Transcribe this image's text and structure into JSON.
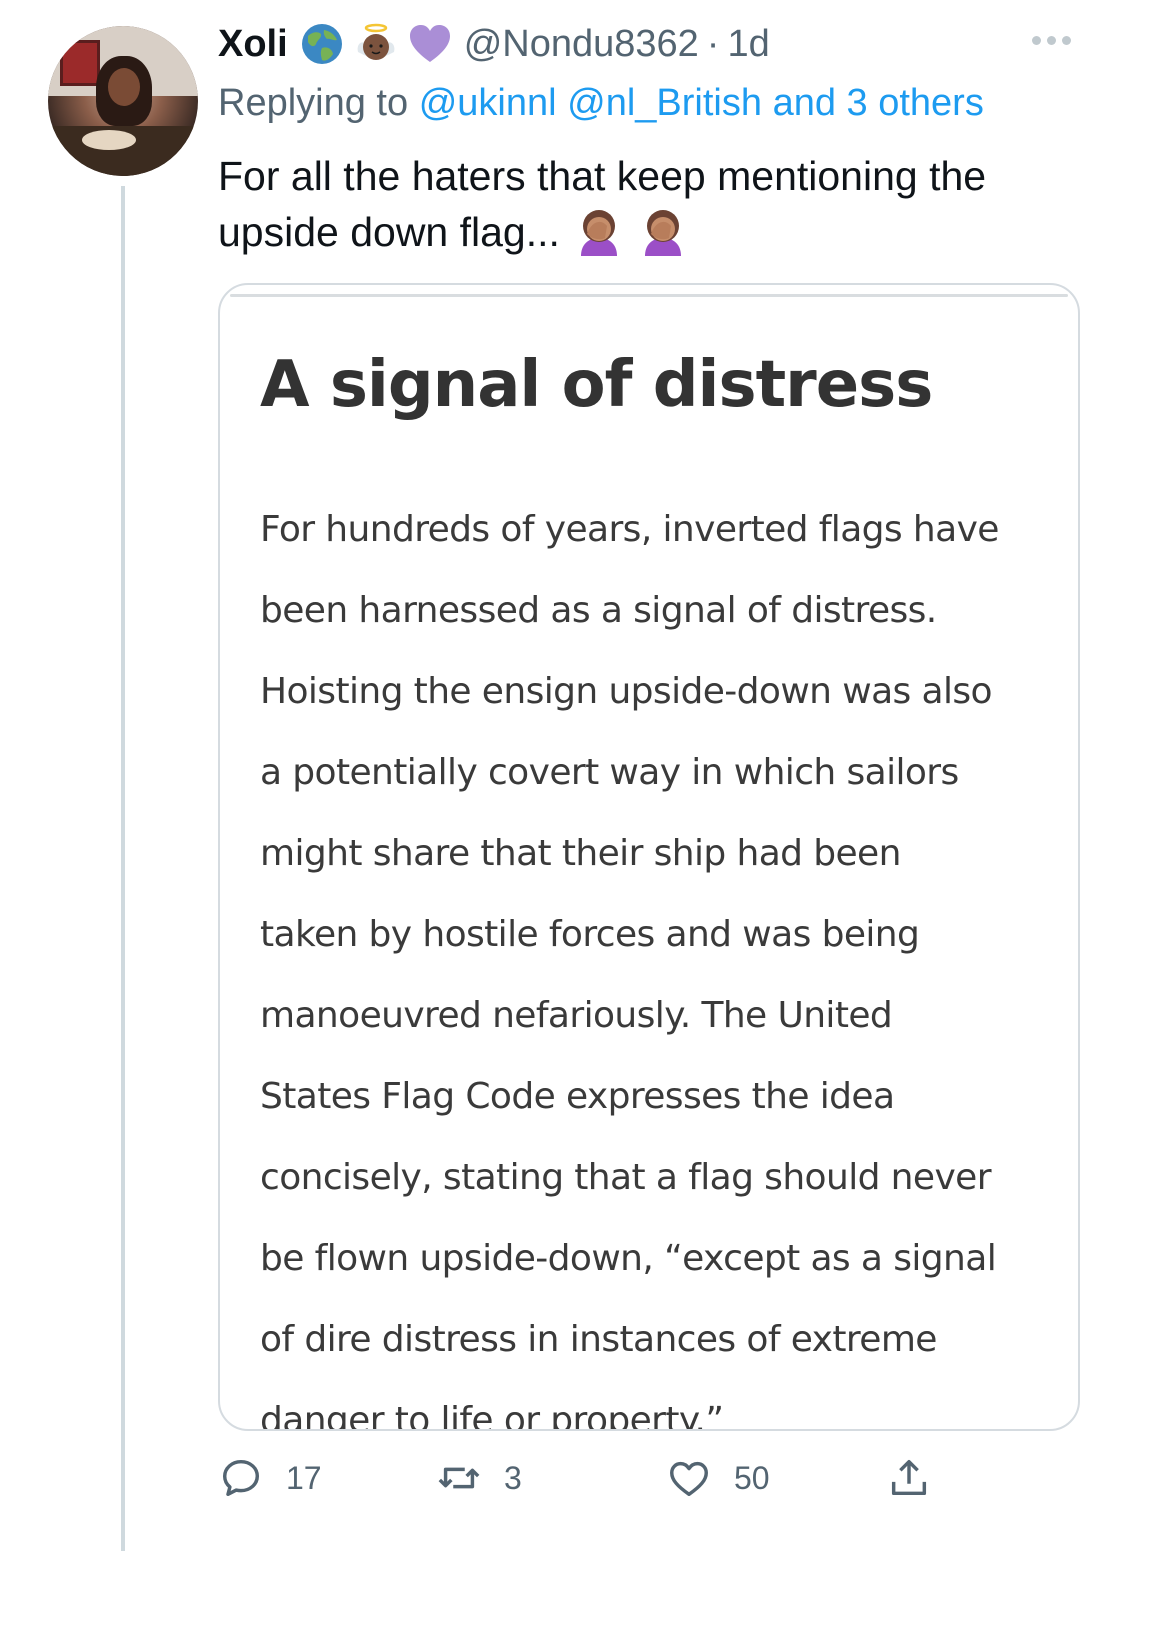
{
  "tweet": {
    "author_name": "Xoli",
    "name_emojis": [
      "globe-emoji",
      "baby-angel-emoji",
      "purple-heart-emoji"
    ],
    "handle": "@Nondu8362",
    "separator": "·",
    "age": "1d",
    "replying_prefix": "Replying to",
    "mentions": [
      "@ukinnl",
      "@nl_British"
    ],
    "mention_others": "and 3 others",
    "text": "For all the haters that keep mentioning the upside down flag...",
    "text_emojis": [
      "facepalm-emoji",
      "facepalm-emoji"
    ]
  },
  "card": {
    "title": "A signal of distress",
    "lines": [
      "For hundreds of years, inverted flags have",
      "been harnessed as a signal of distress.",
      "Hoisting the ensign upside-down was also",
      "a potentially covert way in which sailors",
      "might share that their ship had been",
      "taken by hostile forces and was being",
      "manoeuvred nefariously. The United",
      "States Flag Code expresses the idea",
      "concisely, stating that a flag should never",
      "be flown upside-down, “except as a signal",
      "of dire distress in instances of extreme",
      "danger to life or property.”"
    ]
  },
  "actions": {
    "replies": "17",
    "retweets": "3",
    "likes": "50"
  },
  "colors": {
    "text_primary": "#0f1419",
    "text_secondary": "#536471",
    "link": "#1d9bf0",
    "border": "#cfd9de"
  }
}
